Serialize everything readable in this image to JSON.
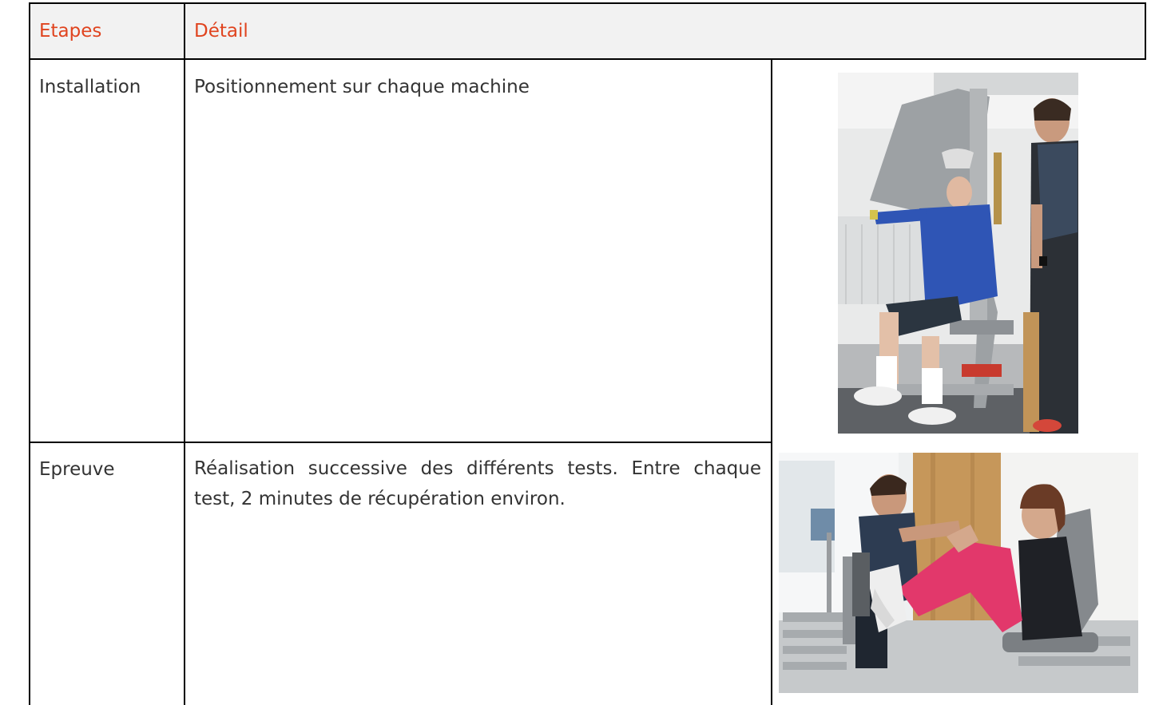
{
  "table": {
    "headers": {
      "stages": "Etapes",
      "detail": "Détail"
    },
    "rows": [
      {
        "stage": "Installation",
        "detail": "Positionnement sur chaque machine",
        "photo": "older-man-on-chest-press-machine-with-trainer"
      },
      {
        "stage": "Epreuve",
        "detail": "Réalisation successive des différents tests. Entre chaque test, 2 minutes de récupération environ.",
        "photo": "trainer-assisting-woman-on-leg-press-machine"
      }
    ]
  },
  "colors": {
    "header_text": "#e0441f",
    "header_background": "#f2f2f2",
    "border": "#000000",
    "body_text": "#333333"
  }
}
